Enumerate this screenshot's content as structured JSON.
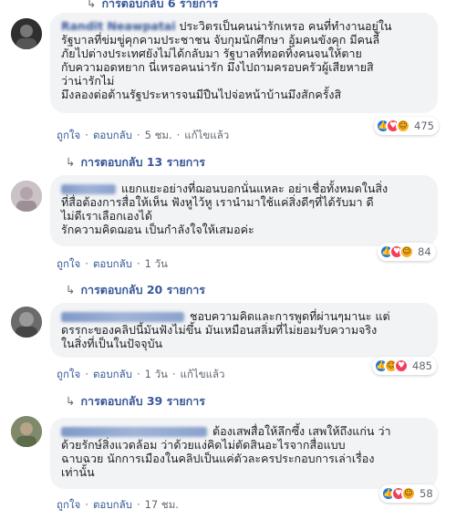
{
  "top_reply_label": "การตอบกลับ 6 รายการ",
  "actions": {
    "like": "ถูกใจ",
    "reply": "ตอบกลับ",
    "edited": "แก้ไขแล้ว"
  },
  "comments": [
    {
      "author": "Randit Neawpatai",
      "lines": [
        "ประวิตรเป็นคนน่ารักเหรอ คนที่ทำงานอยู่ใน",
        "รัฐบาลที่ข่มขู่คุกคามประชาชน จับกุมนักศึกษา อุ้มคนขังคุก มีคนลี้",
        "ภัยไปต่างประเทศยังไม่ได้กลับมา รัฐบาลที่ทอดทิ้งคนจนให้ตาย",
        "กับความอดหยาก นี่เหรอคนน่ารัก มึงไปถามครอบครัวผู้เสียหายสิ",
        "ว่าน่ารักไม่",
        "มึงลองต่อต้านรัฐประหารจนมีปืนไปจ่อหน้าบ้านมึงสักครั้งสิ"
      ],
      "time": "5 ชม.",
      "reaction_count": "475",
      "reaction_icons": [
        "like-icon",
        "love-icon",
        "wow-icon"
      ],
      "reply_count": "การตอบกลับ 13 รายการ"
    },
    {
      "author": "",
      "lines": [
        "แยกแยะอย่างที่ฌอนบอกนั่นแหละ อย่าเชื่อทั้งหมดในสิ่ง",
        "ที่สื่อต้องการสื่อให้เห็น ฟังหูไว้หู เรานำมาใช้แค่สิ่งดีๆที่ได้รับมา ดี",
        "ไม่ดีเราเลือกเองได้",
        "รักความคิดฌอน เป็นกำลังใจให้เสมอค่ะ"
      ],
      "time": "1 วัน",
      "reaction_count": "84",
      "reaction_icons": [
        "like-icon",
        "love-icon",
        "haha-icon"
      ],
      "reply_count": "การตอบกลับ 20 รายการ"
    },
    {
      "author": "",
      "lines": [
        "ชอบความคิดและการพูดที่ผ่านๆมานะ แต่",
        "ดรรกะของคลิปนี้มันฟังไม่ขึ้น มันเหมือนสลิ่มที่ไม่ยอมรับความจริง",
        "ในสิ่งที่เป็นในปัจจุบัน"
      ],
      "time": "1 วัน",
      "reaction_count": "485",
      "reaction_icons": [
        "like-icon",
        "haha-icon",
        "love-icon"
      ],
      "reply_count": "การตอบกลับ 39 รายการ"
    },
    {
      "author": "",
      "lines": [
        "ต้องเสพสื่อให้ลึกซึ้ง เสพให้ถึงแก่น ว่า",
        "ด้วยรักษ์สิ่งแวดล้อม ว่าด้วยแง่คิดไม่ตัดสินอะไรจากสื่อแบบ",
        "ฉาบฉวย นักการเมืองในคลิปเป็นแค่ตัวละครประกอบการเล่าเรื่อง",
        "เท่านั้น"
      ],
      "time": "17 ชม.",
      "reaction_count": "58",
      "reaction_icons": [
        "like-icon",
        "love-icon",
        "haha-icon"
      ],
      "reply_count": ""
    }
  ],
  "colors": {
    "link": "#385898",
    "bubble": "#f2f3f5",
    "like": "#1877f2",
    "love": "#f33e58",
    "haha": "#f7b125"
  }
}
